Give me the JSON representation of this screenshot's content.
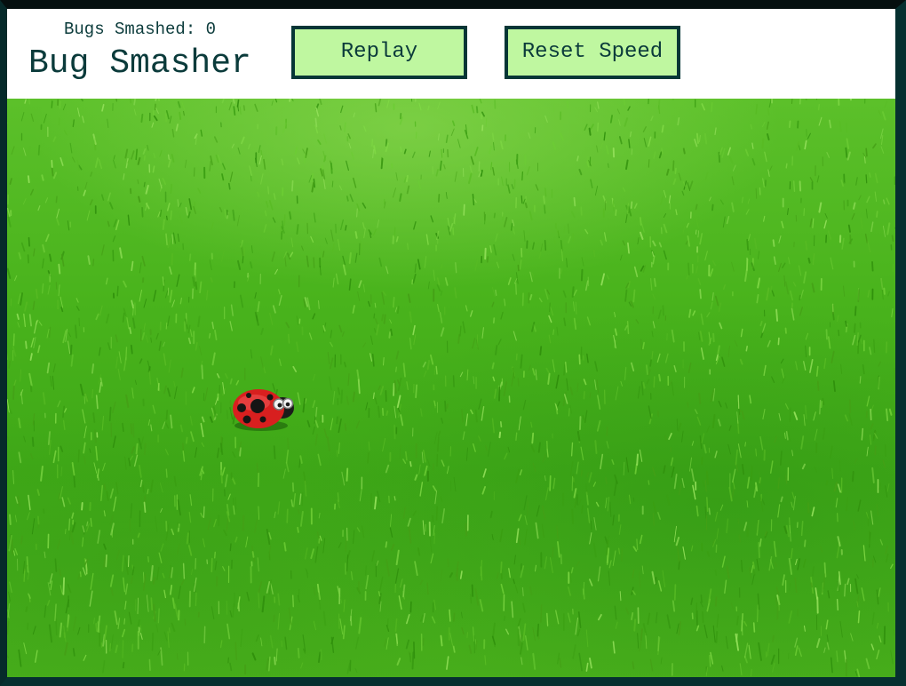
{
  "header": {
    "score_label": "Bugs Smashed: 0",
    "title": "Bug Smasher"
  },
  "buttons": {
    "replay_label": "Replay",
    "reset_speed_label": "Reset Speed"
  },
  "colors": {
    "button_bg": "#bff7a0",
    "button_border": "#063636",
    "text": "#0b3b3b",
    "grass": "#49b31c",
    "frame": "#063030"
  },
  "game": {
    "bug_type": "ladybug",
    "bugs_smashed": 0
  }
}
